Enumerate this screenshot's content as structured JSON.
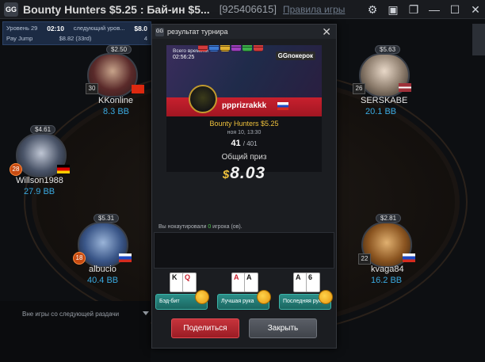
{
  "window": {
    "title": "Bounty Hunters $5.25 : Бай-ин $5...",
    "table_id": "[925406615]",
    "rules_link": "Правила игры"
  },
  "infobar": {
    "level": "Уровень 29",
    "time": "02:10",
    "next_label": "следующий уров...",
    "blind_right": "$8.0",
    "pay_jump": "Pay Jump",
    "pay_jump_value": "$8.82 (33rd)",
    "pay_right": "4"
  },
  "players": [
    {
      "name": "KKonline",
      "bb": "8.3 BB",
      "stack": "$2.50",
      "level": "30",
      "flag": "cn"
    },
    {
      "name": "SERSKABE",
      "bb": "20.1 BB",
      "stack": "$5.63",
      "level": "26",
      "flag": "lv"
    },
    {
      "name": "Willson1988",
      "bb": "27.9 BB",
      "stack": "$4.61",
      "level": "28",
      "flag": "de"
    },
    {
      "name": "albucio",
      "bb": "40.4 BB",
      "stack": "$5.31",
      "level": "18",
      "flag": "ru"
    },
    {
      "name": "kvaga84",
      "bb": "16.2 BB",
      "stack": "$2.81",
      "level": "22",
      "flag": "ru"
    }
  ],
  "bottom": {
    "sitout_text": "Вне игры со следующей раздачи"
  },
  "modal": {
    "title": "результат турнира",
    "total_time_label": "Всего времени",
    "total_time": "02:56:25",
    "brand": "GGпокерок",
    "winner_name": "ppprizrakkk",
    "tournament_name": "Bounty Hunters $5.25",
    "date": "ноя 10, 13:30",
    "place": "41",
    "total_players": "/ 401",
    "prize_label": "Общий приз",
    "prize_currency": "$",
    "prize_value": "8.03",
    "knockout_prefix": "Вы нокаутировали ",
    "knockout_count": "0",
    "knockout_suffix": " игрока (ов).",
    "hands": [
      {
        "label": "Бэд-бит",
        "cards": [
          "K",
          "Q"
        ]
      },
      {
        "label": "Лучшая рука",
        "cards": [
          "A",
          "A"
        ]
      },
      {
        "label": "Последняя рука",
        "cards": [
          "A",
          "6"
        ]
      }
    ],
    "share_label": "Поделиться",
    "close_label": "Закрыть"
  },
  "colors": {
    "accent_red": "#c8202e",
    "bb_blue": "#3aa9e0",
    "gold": "#f0c23c",
    "teal": "#2b8e88"
  }
}
